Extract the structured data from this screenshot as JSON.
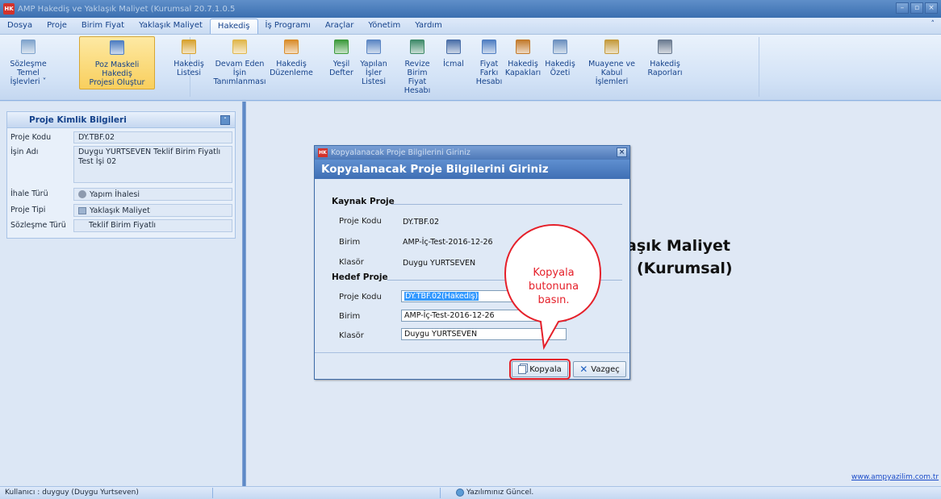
{
  "window": {
    "title": "AMP Hakediş ve Yaklaşık Maliyet (Kurumsal 20.7.1.0.5",
    "app_icon_text": "HK",
    "controls": [
      "–",
      "▫",
      "×"
    ]
  },
  "menu": {
    "tabs": [
      "Dosya",
      "Proje",
      "Birim Fiyat",
      "Yaklaşık Maliyet",
      "Hakediş",
      "İş Programı",
      "Araçlar",
      "Yönetim",
      "Yardım"
    ],
    "active_tab": "Hakediş",
    "collapse_glyph": "˄"
  },
  "ribbon": {
    "buttons": [
      {
        "line1": "Sözleşme",
        "line2": "Temel İşlevleri ˅",
        "icon": "edit-document-icon",
        "color": "#7fa3cc"
      },
      {
        "line1": "Poz Maskeli Hakediş",
        "line2": "Projesi Oluştur",
        "icon": "excel-document-icon",
        "color": "#4f7ec2"
      },
      {
        "line1": "Hakediş",
        "line2": "Listesi",
        "icon": "folder-people-icon",
        "color": "#d7a22f"
      },
      {
        "line1": "Devam Eden İşin",
        "line2": "Tanımlanması",
        "icon": "document-copy-icon",
        "color": "#e0b64b"
      },
      {
        "line1": "Hakediş",
        "line2": "Düzenleme",
        "icon": "pencil-ruler-icon",
        "color": "#d98c2a"
      },
      {
        "line1": "Yeşil",
        "line2": "Defter",
        "icon": "green-book-icon",
        "color": "#3c9a3c"
      },
      {
        "line1": "Yapılan",
        "line2": "İşler Listesi",
        "icon": "list-grid-icon",
        "color": "#5b86c4"
      },
      {
        "line1": "Revize Birim",
        "line2": "Fiyat Hesabı",
        "icon": "window-grid-icon",
        "color": "#3f8a6a"
      },
      {
        "line1": "İcmal",
        "line2": "",
        "icon": "abacus-icon",
        "color": "#4a6fa8"
      },
      {
        "line1": "Fiyat Farkı",
        "line2": "Hesabı",
        "icon": "stack-sheets-icon",
        "color": "#4f7ec2"
      },
      {
        "line1": "Hakediş",
        "line2": "Kapakları",
        "icon": "box-stack-icon",
        "color": "#c27a2c"
      },
      {
        "line1": "Hakediş",
        "line2": "Özeti",
        "icon": "magnifier-doc-icon",
        "color": "#6b8fbf"
      },
      {
        "line1": "Muayene ve",
        "line2": "Kabul İşlemleri",
        "icon": "clipboard-icon",
        "color": "#c49a3c"
      },
      {
        "line1": "Hakediş",
        "line2": "Raporları",
        "icon": "printer-icon",
        "color": "#6a7a90"
      }
    ],
    "selected_index": 1
  },
  "info_panel": {
    "header": "Proje Kimlik Bilgileri",
    "rows": [
      {
        "label": "Proje Kodu",
        "value": "DY.TBF.02"
      },
      {
        "label": "İşin Adı",
        "value": "Duygu YURTSEVEN Teklif Birim Fiyatlı Test İşi 02"
      },
      {
        "label": "İhale Türü",
        "value": "Yapım İhalesi",
        "icon": "gear-people-icon"
      },
      {
        "label": "Proje Tipi",
        "value": "Yaklaşık Maliyet",
        "icon": "calculator-icon"
      },
      {
        "label": "Sözleşme Türü",
        "value": "Teklif Birim Fiyatlı"
      }
    ]
  },
  "background_text": {
    "line1": "aşık Maliyet",
    "line2": "(Kurumsal)",
    "website": "www.ampyazilim.com.tr"
  },
  "dialog": {
    "window_title": "Kopyalanacak Proje Bilgilerini Giriniz",
    "header": "Kopyalanacak Proje Bilgilerini Giriniz",
    "source_section": "Kaynak Proje",
    "target_section": "Hedef Proje",
    "labels": {
      "code": "Proje Kodu",
      "unit": "Birim",
      "folder": "Klasör"
    },
    "source": {
      "code": "DY.TBF.02",
      "unit": "AMP-İç-Test-2016-12-26",
      "folder": "Duygu YURTSEVEN"
    },
    "target": {
      "code": "DY.TBF.02(Hakediş)",
      "unit": "AMP-İç-Test-2016-12-26",
      "folder": "Duygu YURTSEVEN"
    },
    "copy_button": "Kopyala",
    "cancel_button": "Vazgeç"
  },
  "callout": {
    "text": "Kopyala butonuna basın.",
    "color": "#e5202a"
  },
  "status_bar": {
    "user": "Kullanıcı : duyguy  (Duygu Yurtseven)",
    "software_status": "Yazılımınız Güncel."
  }
}
